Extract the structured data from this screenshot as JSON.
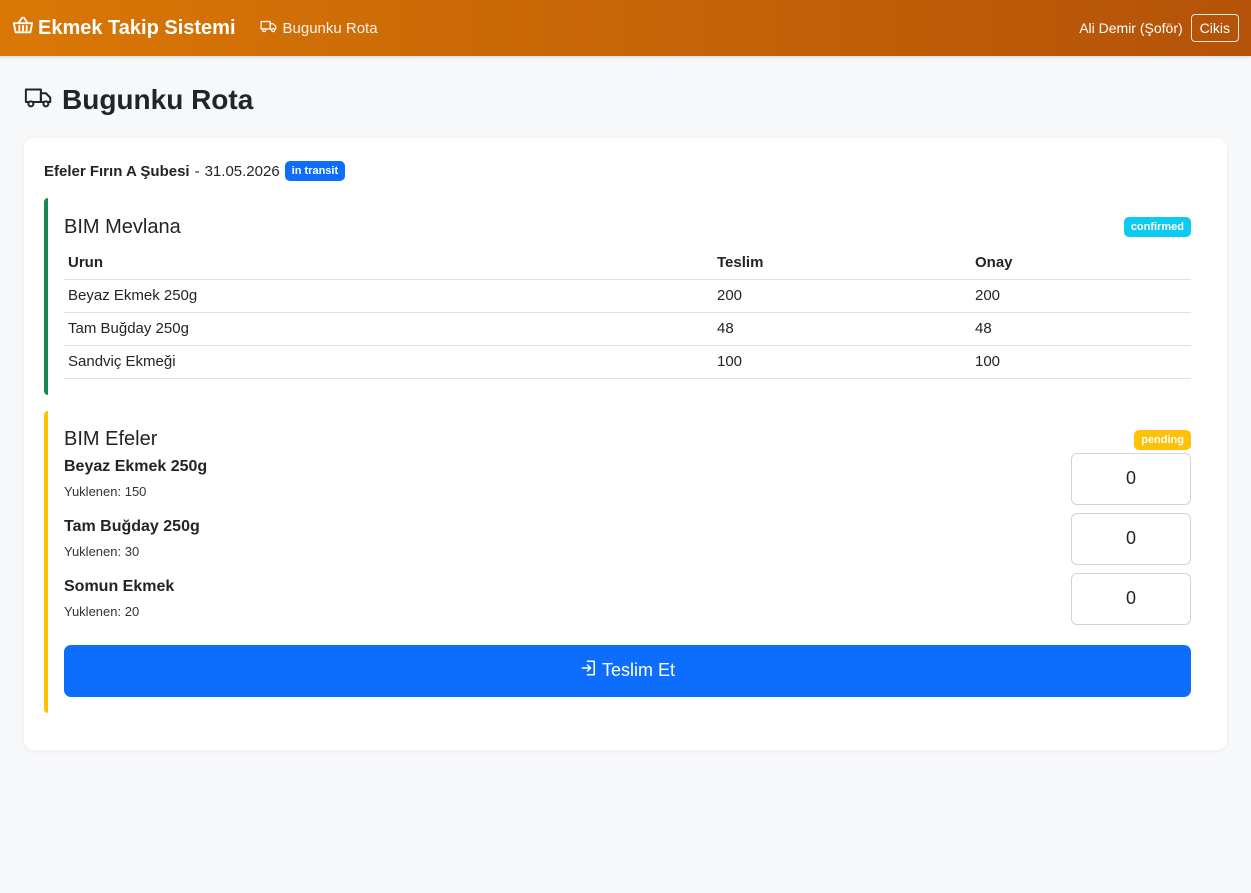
{
  "navbar": {
    "brand": "Ekmek Takip Sistemi",
    "brand_icon": "basket-icon",
    "nav_link": "Bugunku Rota",
    "nav_icon": "truck-icon",
    "user": "Ali Demir (Şoför)",
    "logout": "Cikis"
  },
  "page": {
    "title": "Bugunku Rota",
    "title_icon": "truck-icon"
  },
  "route": {
    "branch": "Efeler Fırın A Şubesi",
    "separator": "-",
    "date": "31.05.2026",
    "status": "in transit"
  },
  "stops": [
    {
      "name": "BIM Mevlana",
      "status": "confirmed",
      "columns": [
        "Urun",
        "Teslim",
        "Onay"
      ],
      "rows": [
        [
          "Beyaz Ekmek 250g",
          "200",
          "200"
        ],
        [
          "Tam Buğday 250g",
          "48",
          "48"
        ],
        [
          "Sandviç Ekmeği",
          "100",
          "100"
        ]
      ]
    },
    {
      "name": "BIM Efeler",
      "status": "pending",
      "items": [
        {
          "name": "Beyaz Ekmek 250g",
          "loaded": "Yuklenen: 150",
          "value": "0"
        },
        {
          "name": "Tam Buğday 250g",
          "loaded": "Yuklenen: 30",
          "value": "0"
        },
        {
          "name": "Somun Ekmek",
          "loaded": "Yuklenen: 20",
          "value": "0"
        }
      ],
      "submit": "Teslim Et",
      "submit_icon": "login-arrow-icon"
    }
  ],
  "colors": {
    "nav_start": "#d97706",
    "nav_end": "#b45309",
    "primary": "#0d6efd",
    "confirmed": "#0dcaf0",
    "pending": "#ffc107",
    "success_border": "#198754"
  }
}
